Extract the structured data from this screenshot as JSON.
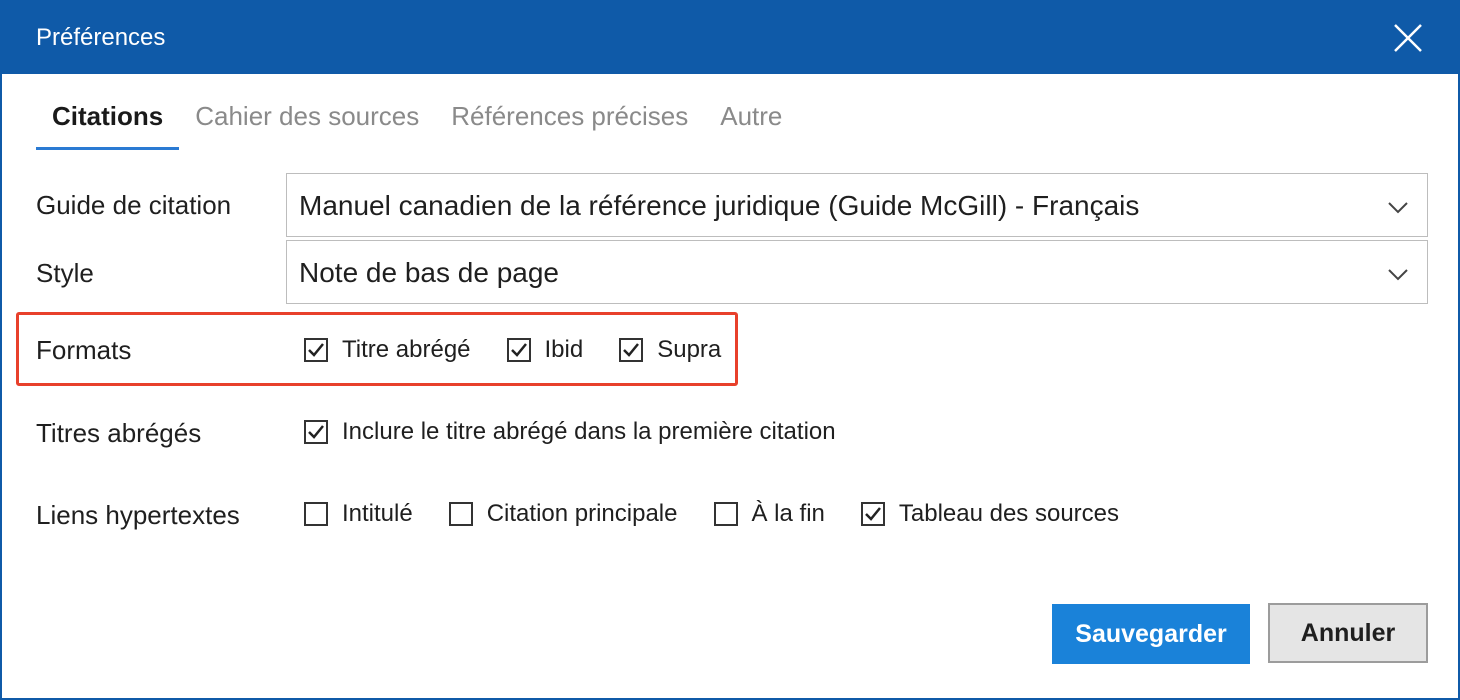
{
  "window": {
    "title": "Préférences"
  },
  "tabs": [
    {
      "label": "Citations",
      "active": true
    },
    {
      "label": "Cahier des sources",
      "active": false
    },
    {
      "label": "Références précises",
      "active": false
    },
    {
      "label": "Autre",
      "active": false
    }
  ],
  "citation_guide": {
    "label": "Guide de citation",
    "value": "Manuel canadien de la référence juridique (Guide McGill) - Français"
  },
  "style": {
    "label": "Style",
    "value": "Note de bas de page"
  },
  "formats": {
    "label": "Formats",
    "options": [
      {
        "label": "Titre abrégé",
        "checked": true
      },
      {
        "label": "Ibid",
        "checked": true
      },
      {
        "label": "Supra",
        "checked": true
      }
    ]
  },
  "short_titles": {
    "label": "Titres abrégés",
    "options": [
      {
        "label": "Inclure le titre abrégé dans la première citation",
        "checked": true
      }
    ]
  },
  "hyperlinks": {
    "label": "Liens hypertextes",
    "options": [
      {
        "label": "Intitulé",
        "checked": false
      },
      {
        "label": "Citation principale",
        "checked": false
      },
      {
        "label": "À la fin",
        "checked": false
      },
      {
        "label": "Tableau des sources",
        "checked": true
      }
    ]
  },
  "buttons": {
    "save": "Sauvegarder",
    "cancel": "Annuler"
  },
  "colors": {
    "titlebar": "#0f5aa8",
    "accent": "#1a82d9",
    "highlight": "#e8402b"
  }
}
